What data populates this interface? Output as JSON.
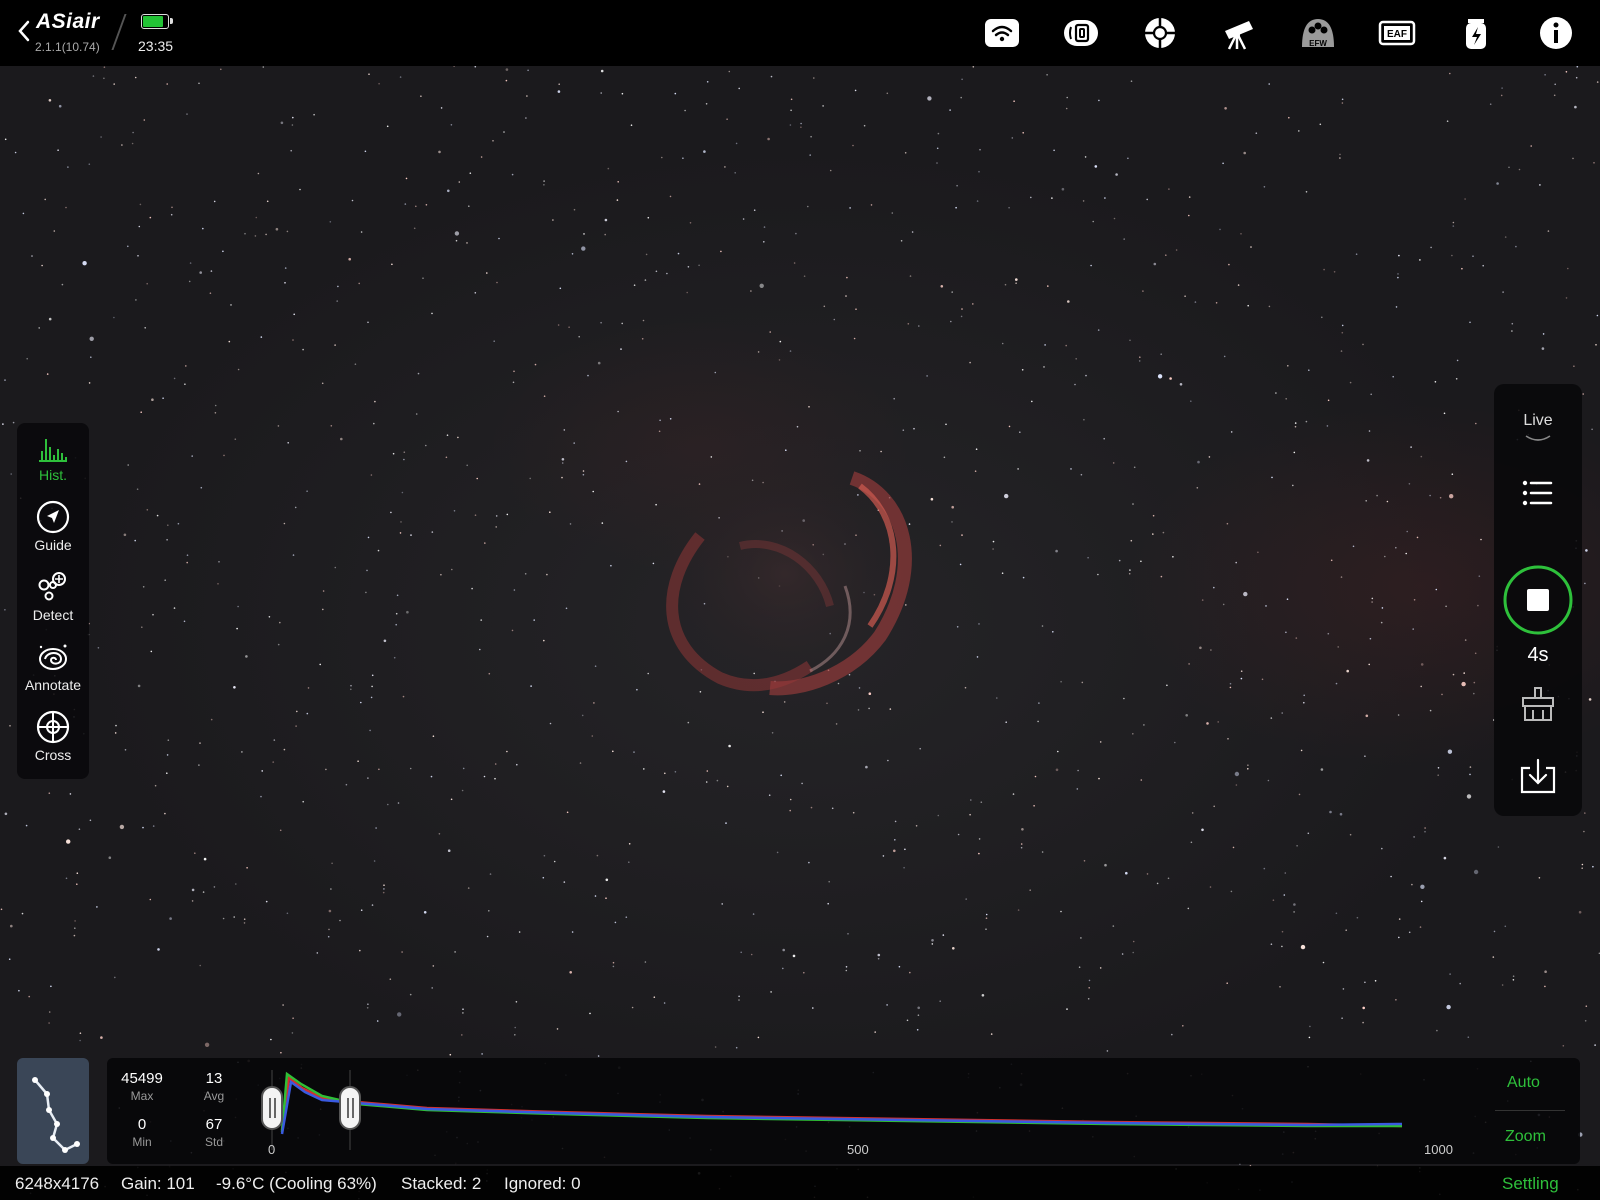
{
  "app": {
    "name": "ASiair",
    "version": "2.1.1(10.74)",
    "time": "23:35",
    "battery_level": 0.85,
    "battery_color": "#22c235",
    "accent_color": "#2ec03b"
  },
  "toolbar_icons": [
    "wifi-icon",
    "camera-icon",
    "guide-scope-icon",
    "telescope-icon",
    "filter-wheel-icon",
    "focuser-icon",
    "power-icon",
    "info-icon"
  ],
  "toolbar_text": {
    "efw": "EFW",
    "eaf": "EAF"
  },
  "left_tools": [
    {
      "label": "Hist.",
      "icon": "histogram-icon",
      "active": true
    },
    {
      "label": "Guide",
      "icon": "compass-icon",
      "active": false
    },
    {
      "label": "Detect",
      "icon": "stars-icon",
      "active": false
    },
    {
      "label": "Annotate",
      "icon": "galaxy-icon",
      "active": false
    },
    {
      "label": "Cross",
      "icon": "crosshair-icon",
      "active": false
    }
  ],
  "right_panel": {
    "mode_label": "Live",
    "exposure": "4s",
    "buttons": [
      "list-icon",
      "clear-icon",
      "save-icon"
    ]
  },
  "histogram": {
    "max_value": "45499",
    "max_label": "Max",
    "avg_value": "13",
    "avg_label": "Avg",
    "min_value": "0",
    "min_label": "Min",
    "std_value": "67",
    "std_label": "Std",
    "axis_ticks": [
      "0",
      "500",
      "1000"
    ],
    "auto_label": "Auto",
    "zoom_label": "Zoom",
    "low_stretch": 0,
    "high_stretch": 130
  },
  "status": {
    "resolution": "6248x4176",
    "gain": "Gain: 101",
    "temperature": "-9.6°C (Cooling 63%)",
    "stacked": "Stacked: 2",
    "ignored": "Ignored: 0",
    "setting_label": "Settling"
  }
}
